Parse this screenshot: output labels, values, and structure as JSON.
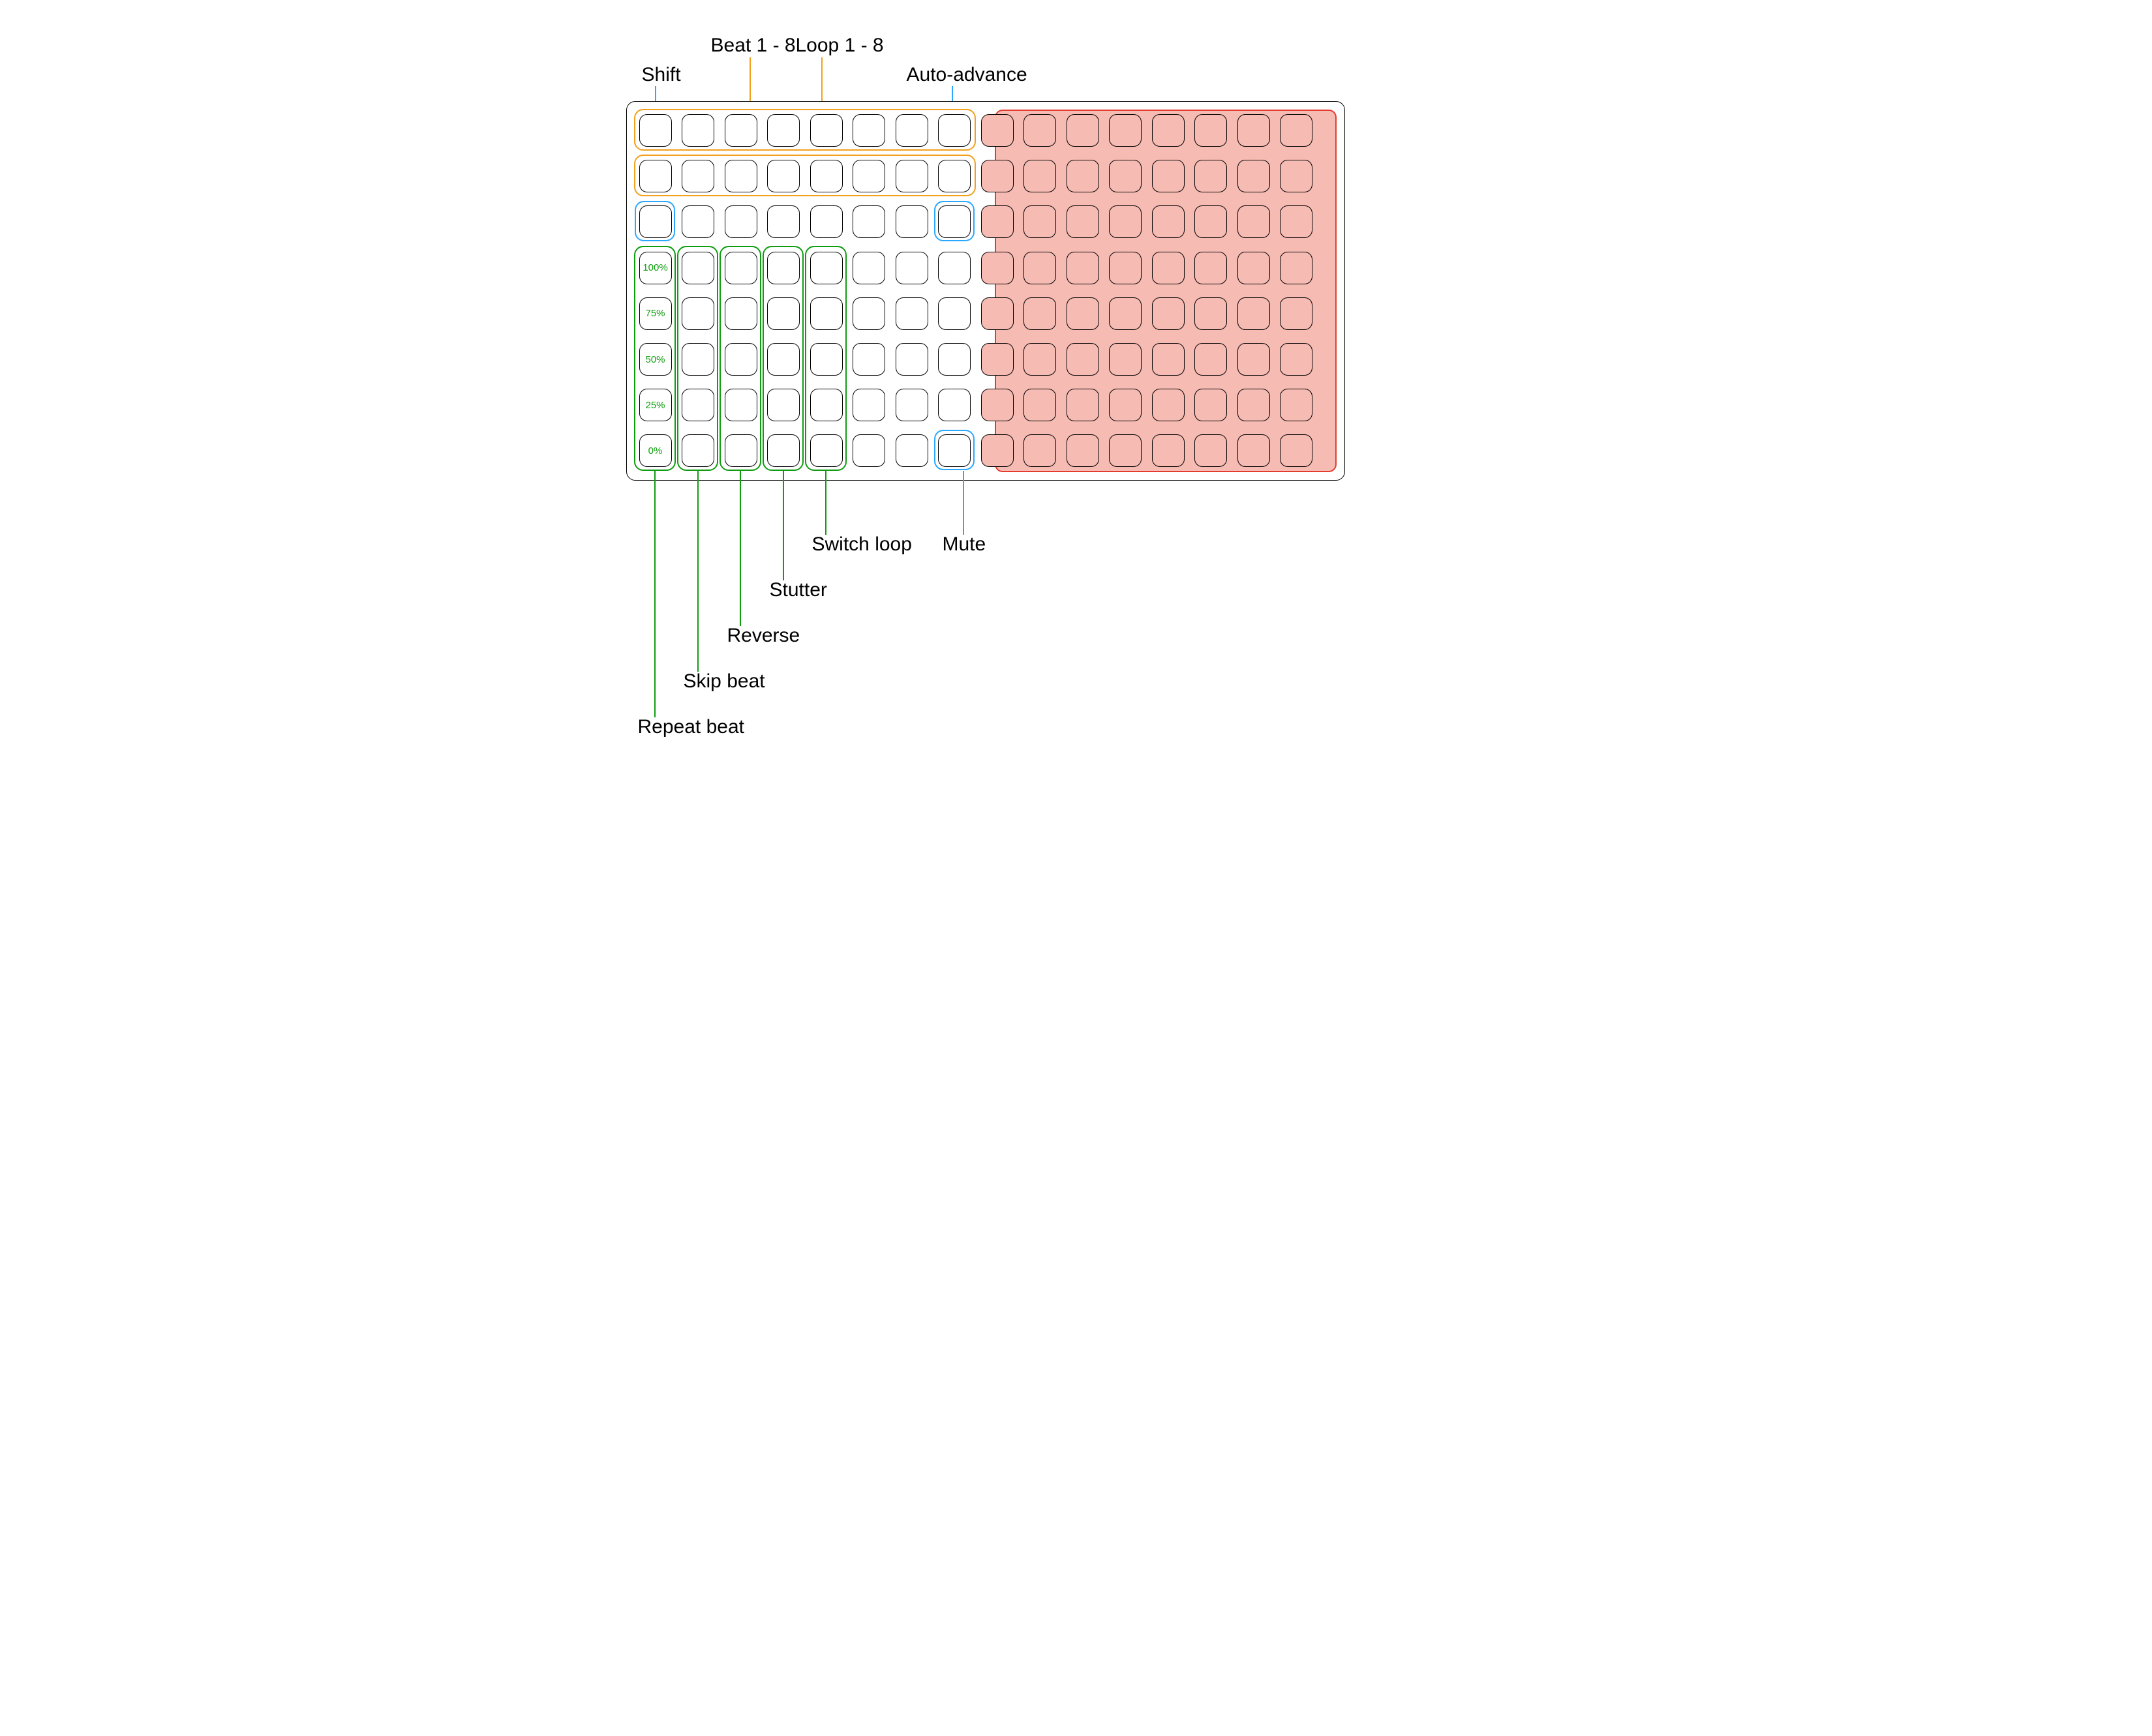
{
  "labels": {
    "shift": "Shift",
    "beat": "Beat 1 - 8",
    "loop": "Loop 1 - 8",
    "auto_advance": "Auto-advance",
    "switch_loop": "Switch loop",
    "stutter": "Stutter",
    "reverse": "Reverse",
    "skip_beat": "Skip beat",
    "repeat_beat": "Repeat beat",
    "mute": "Mute"
  },
  "percent_column_values": [
    "100%",
    "75%",
    "50%",
    "25%",
    "0%"
  ],
  "grid": {
    "cols": 16,
    "rows": 8,
    "red_zone_start_col": 9,
    "red_zone_note": "Columns 9-16 (right half) are shaded red/inactive"
  },
  "annotations": {
    "beat_row": "Row 1, columns 1-8 (orange outline)",
    "loop_row": "Row 2, columns 1-8 (orange outline)",
    "shift_pad": "Row 3, column 1 (blue outline)",
    "auto_advance_pad": "Row 3, column 8 (blue outline)",
    "mute_pad": "Row 8, column 8 (blue outline)",
    "green_columns": "Rows 4-8, columns 1-5; column 1 shows percentage labels",
    "green_column_functions": [
      "Repeat beat",
      "Skip beat",
      "Reverse",
      "Stutter",
      "Switch loop"
    ]
  },
  "colors": {
    "orange": "#f2a01d",
    "green": "#0f9d0f",
    "blue": "#2aa8ff",
    "red_border": "#e33b2e",
    "red_fill": "#f6bbb3",
    "black": "#000000"
  }
}
